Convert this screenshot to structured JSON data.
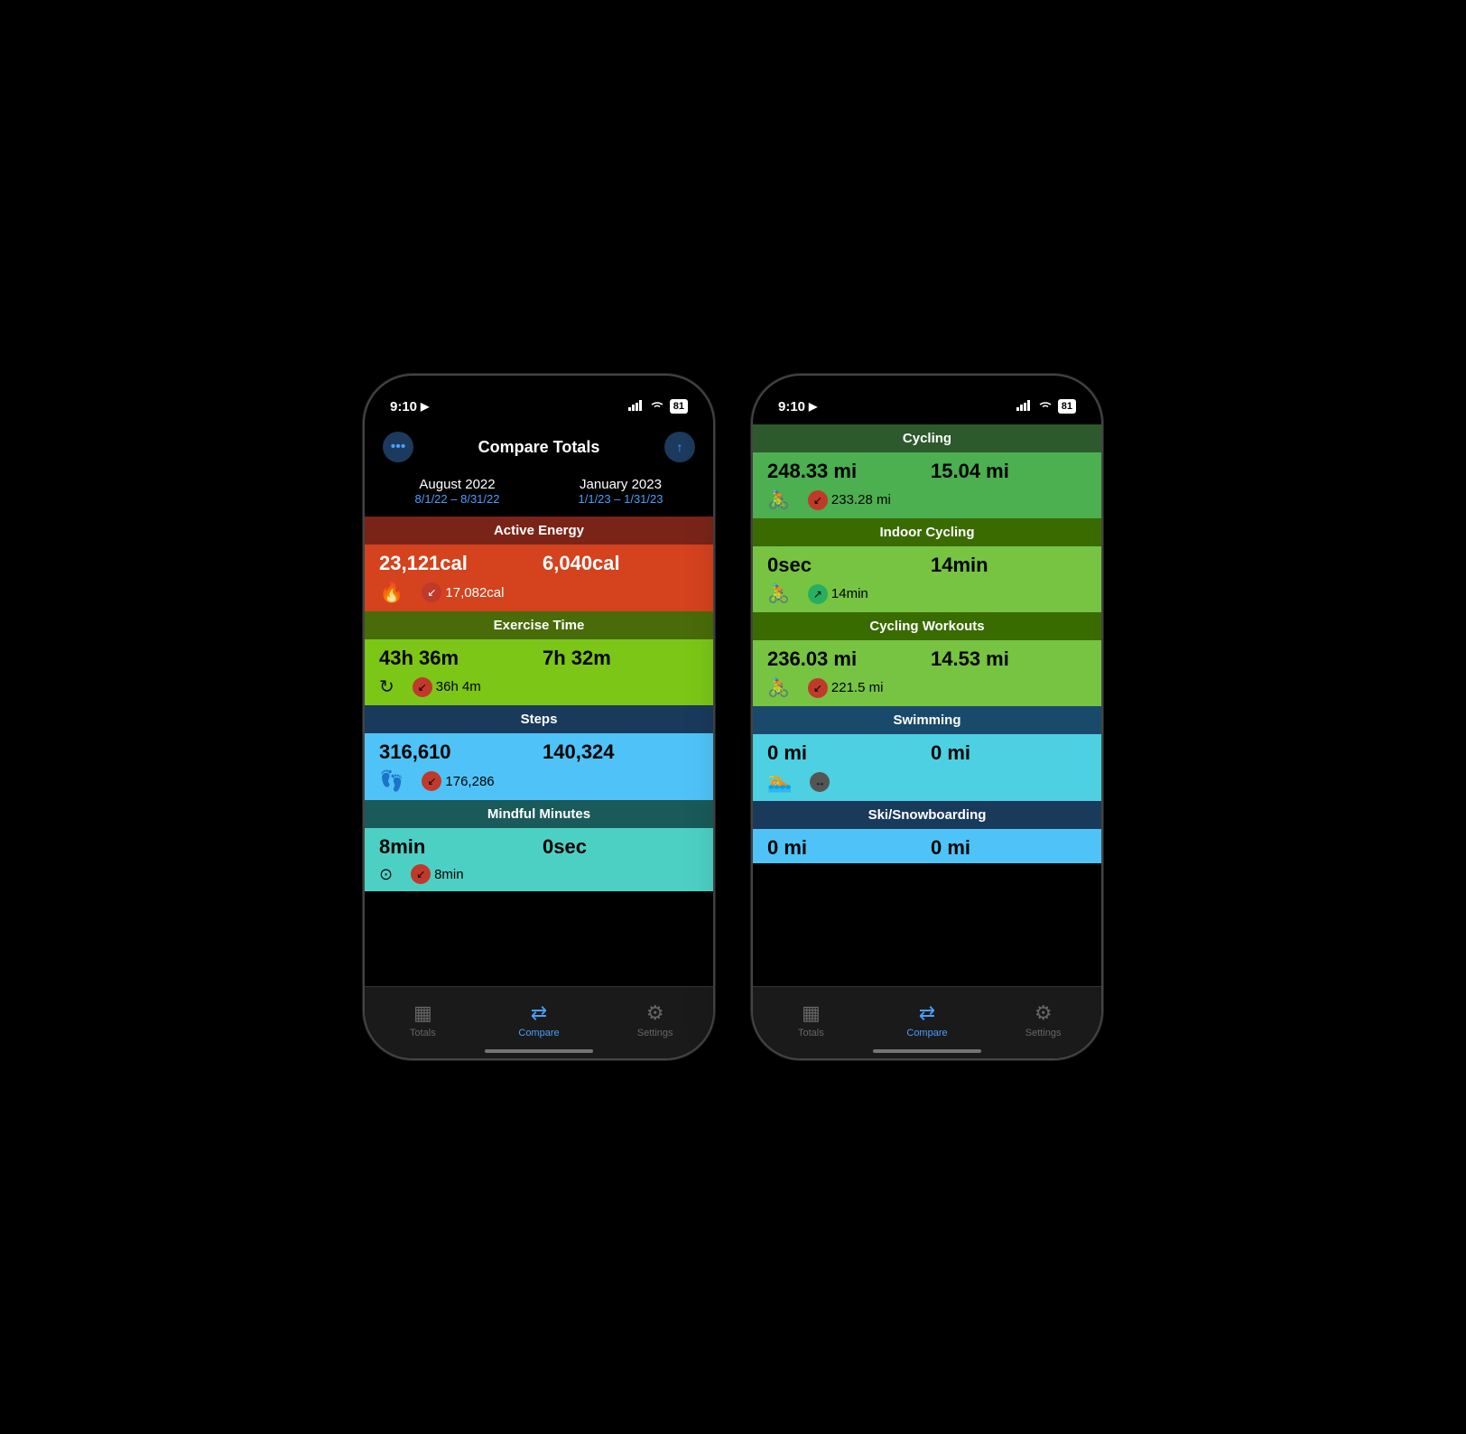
{
  "phones": [
    {
      "id": "phone1",
      "status": {
        "time": "9:10",
        "battery": "81"
      },
      "header": {
        "title": "Compare Totals",
        "menu_btn": "⋯",
        "share_btn": "↑"
      },
      "dates": {
        "col1_main": "August 2022",
        "col1_sub": "8/1/22 – 8/31/22",
        "col2_main": "January 2023",
        "col2_sub": "1/1/23 – 1/31/23"
      },
      "sections": [
        {
          "id": "active-energy",
          "label": "Active Energy",
          "val1": "23,121cal",
          "val2": "6,040cal",
          "diff_icon": "🔥",
          "diff_dir": "down",
          "diff_val": "17,082cal"
        },
        {
          "id": "exercise",
          "label": "Exercise Time",
          "val1": "43h 36m",
          "val2": "7h 32m",
          "diff_icon": "↻",
          "diff_dir": "down",
          "diff_val": "36h 4m"
        },
        {
          "id": "steps",
          "label": "Steps",
          "val1": "316,610",
          "val2": "140,324",
          "diff_icon": "👣",
          "diff_dir": "down",
          "diff_val": "176,286"
        },
        {
          "id": "mindful",
          "label": "Mindful Minutes",
          "val1": "8min",
          "val2": "0sec",
          "diff_icon": "🧘",
          "diff_dir": "down",
          "diff_val": "8min"
        }
      ],
      "tabs": [
        {
          "id": "totals",
          "label": "Totals",
          "icon": "▦",
          "active": false
        },
        {
          "id": "compare",
          "label": "Compare",
          "icon": "⇄",
          "active": true
        },
        {
          "id": "settings",
          "label": "Settings",
          "icon": "⚙",
          "active": false
        }
      ]
    },
    {
      "id": "phone2",
      "status": {
        "time": "9:10",
        "battery": "81"
      },
      "sections": [
        {
          "id": "cycling",
          "label": "Cycling",
          "val1": "248.33 mi",
          "val2": "15.04 mi",
          "diff_icon": "🚴",
          "diff_dir": "down",
          "diff_val": "233.28 mi"
        },
        {
          "id": "indoor-cycling",
          "label": "Indoor Cycling",
          "val1": "0sec",
          "val2": "14min",
          "diff_icon": "🚴",
          "diff_dir": "up",
          "diff_val": "14min"
        },
        {
          "id": "cycling-workouts",
          "label": "Cycling Workouts",
          "val1": "236.03 mi",
          "val2": "14.53 mi",
          "diff_icon": "🚴",
          "diff_dir": "down",
          "diff_val": "221.5 mi"
        },
        {
          "id": "swimming",
          "label": "Swimming",
          "val1": "0 mi",
          "val2": "0 mi",
          "diff_icon": "🏊",
          "diff_dir": "equal",
          "diff_val": ""
        },
        {
          "id": "ski",
          "label": "Ski/Snowboarding",
          "val1": "0 mi",
          "val2": "0 mi",
          "diff_icon": "⛷",
          "diff_dir": "equal",
          "diff_val": ""
        }
      ],
      "tabs": [
        {
          "id": "totals",
          "label": "Totals",
          "icon": "▦",
          "active": false
        },
        {
          "id": "compare",
          "label": "Compare",
          "icon": "⇄",
          "active": true
        },
        {
          "id": "settings",
          "label": "Settings",
          "icon": "⚙",
          "active": false
        }
      ]
    }
  ]
}
